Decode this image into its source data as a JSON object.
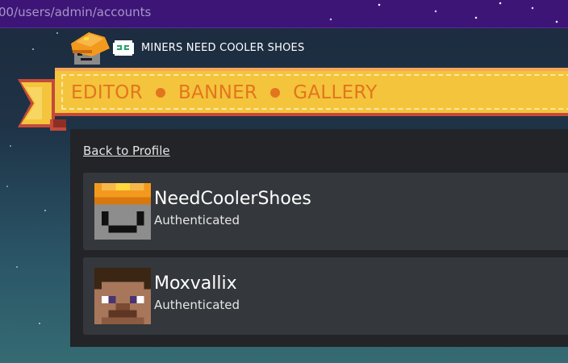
{
  "url": "00/users/admin/accounts",
  "brand": {
    "title": "MINERS NEED COOLER SHOES"
  },
  "nav": [
    {
      "label": "EDITOR"
    },
    {
      "label": "BANNER"
    },
    {
      "label": "GALLERY"
    }
  ],
  "back_link": "Back to Profile",
  "accounts": [
    {
      "name": "NeedCoolerShoes",
      "status": "Authenticated",
      "avatar": "miner-helmet-avatar"
    },
    {
      "name": "Moxvallix",
      "status": "Authenticated",
      "avatar": "steve-avatar"
    }
  ],
  "colors": {
    "banner": "#f4c43c",
    "nav_text": "#e2761e",
    "panel": "#222427",
    "card": "#34373b",
    "urlbar": "#3d1577"
  }
}
